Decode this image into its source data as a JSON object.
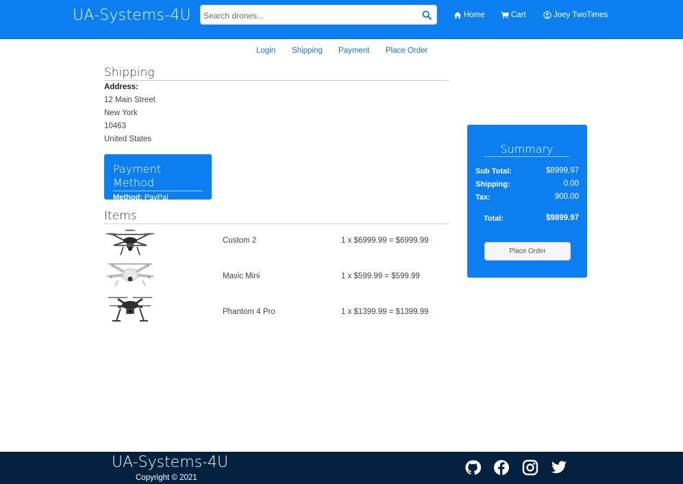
{
  "header": {
    "brand": "UA-Systems-4U",
    "search_placeholder": "Search drones...",
    "nav": [
      {
        "label": "Home",
        "icon": "home-icon"
      },
      {
        "label": "Cart",
        "icon": "cart-icon"
      },
      {
        "label": "Joey TwoTimes",
        "icon": "user-circle-icon"
      }
    ]
  },
  "steps": [
    "Login",
    "Shipping",
    "Payment",
    "Place Order"
  ],
  "shipping": {
    "title": "Shipping",
    "address_label": "Address:",
    "lines": [
      "12 Main Street",
      "New York",
      "10463",
      "United States"
    ]
  },
  "payment": {
    "title": "Payment Method",
    "method_label": "Method:",
    "method_value": "PayPal"
  },
  "items": {
    "title": "Items",
    "rows": [
      {
        "name": "Custom 2",
        "price": "1 x $6999.99 = $6999.99",
        "image": "hexacopter-drone-image"
      },
      {
        "name": "Mavic Mini",
        "price": "1 x $599.99 = $599.99",
        "image": "white-quadcopter-image"
      },
      {
        "name": "Phantom 4 Pro",
        "price": "1 x $1399.99 = $1399.99",
        "image": "dark-quadcopter-image"
      }
    ]
  },
  "summary": {
    "title": "Summary",
    "subtotal_label": "Sub Total:",
    "subtotal_value": "$8999.97",
    "shipping_label": "Shipping:",
    "shipping_value": "0.00",
    "tax_label": "Tax:",
    "tax_value": "900.00",
    "total_label": "Total:",
    "total_value": "$9899.97",
    "button_label": "Place Order"
  },
  "footer": {
    "brand": "UA-Systems-4U",
    "copyright": "Copyright © 2021",
    "social": [
      "github-icon",
      "facebook-icon",
      "instagram-icon",
      "twitter-icon"
    ]
  },
  "colors": {
    "primary": "#0b7ef0",
    "footer": "#04213f",
    "link": "#1a73d9"
  }
}
